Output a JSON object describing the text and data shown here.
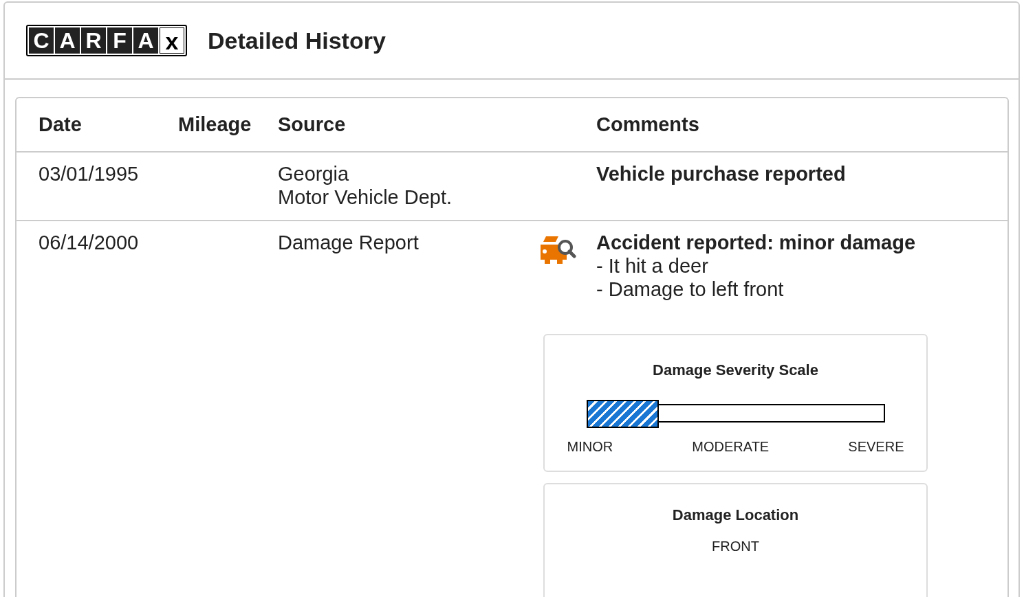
{
  "logo": {
    "letters": [
      "C",
      "A",
      "R",
      "F",
      "A",
      "x"
    ]
  },
  "header": {
    "title": "Detailed History"
  },
  "table": {
    "columns": [
      "Date",
      "Mileage",
      "Source",
      "Comments"
    ],
    "rows": [
      {
        "date": "03/01/1995",
        "source": [
          "Georgia",
          "Motor Vehicle Dept."
        ],
        "kind": "plain",
        "comment_title": "Vehicle purchase reported",
        "details": []
      },
      {
        "date": "06/14/2000",
        "source": [
          "Damage Report"
        ],
        "kind": "damage",
        "comment_title": "Accident reported: minor damage",
        "details": [
          "- It hit a deer",
          "- Damage to left front"
        ],
        "severity": {
          "title": "Damage Severity Scale",
          "level": 0.24,
          "labels": [
            "MINOR",
            "MODERATE",
            "SEVERE"
          ]
        },
        "location": {
          "title": "Damage Location",
          "value": "FRONT"
        }
      }
    ]
  }
}
